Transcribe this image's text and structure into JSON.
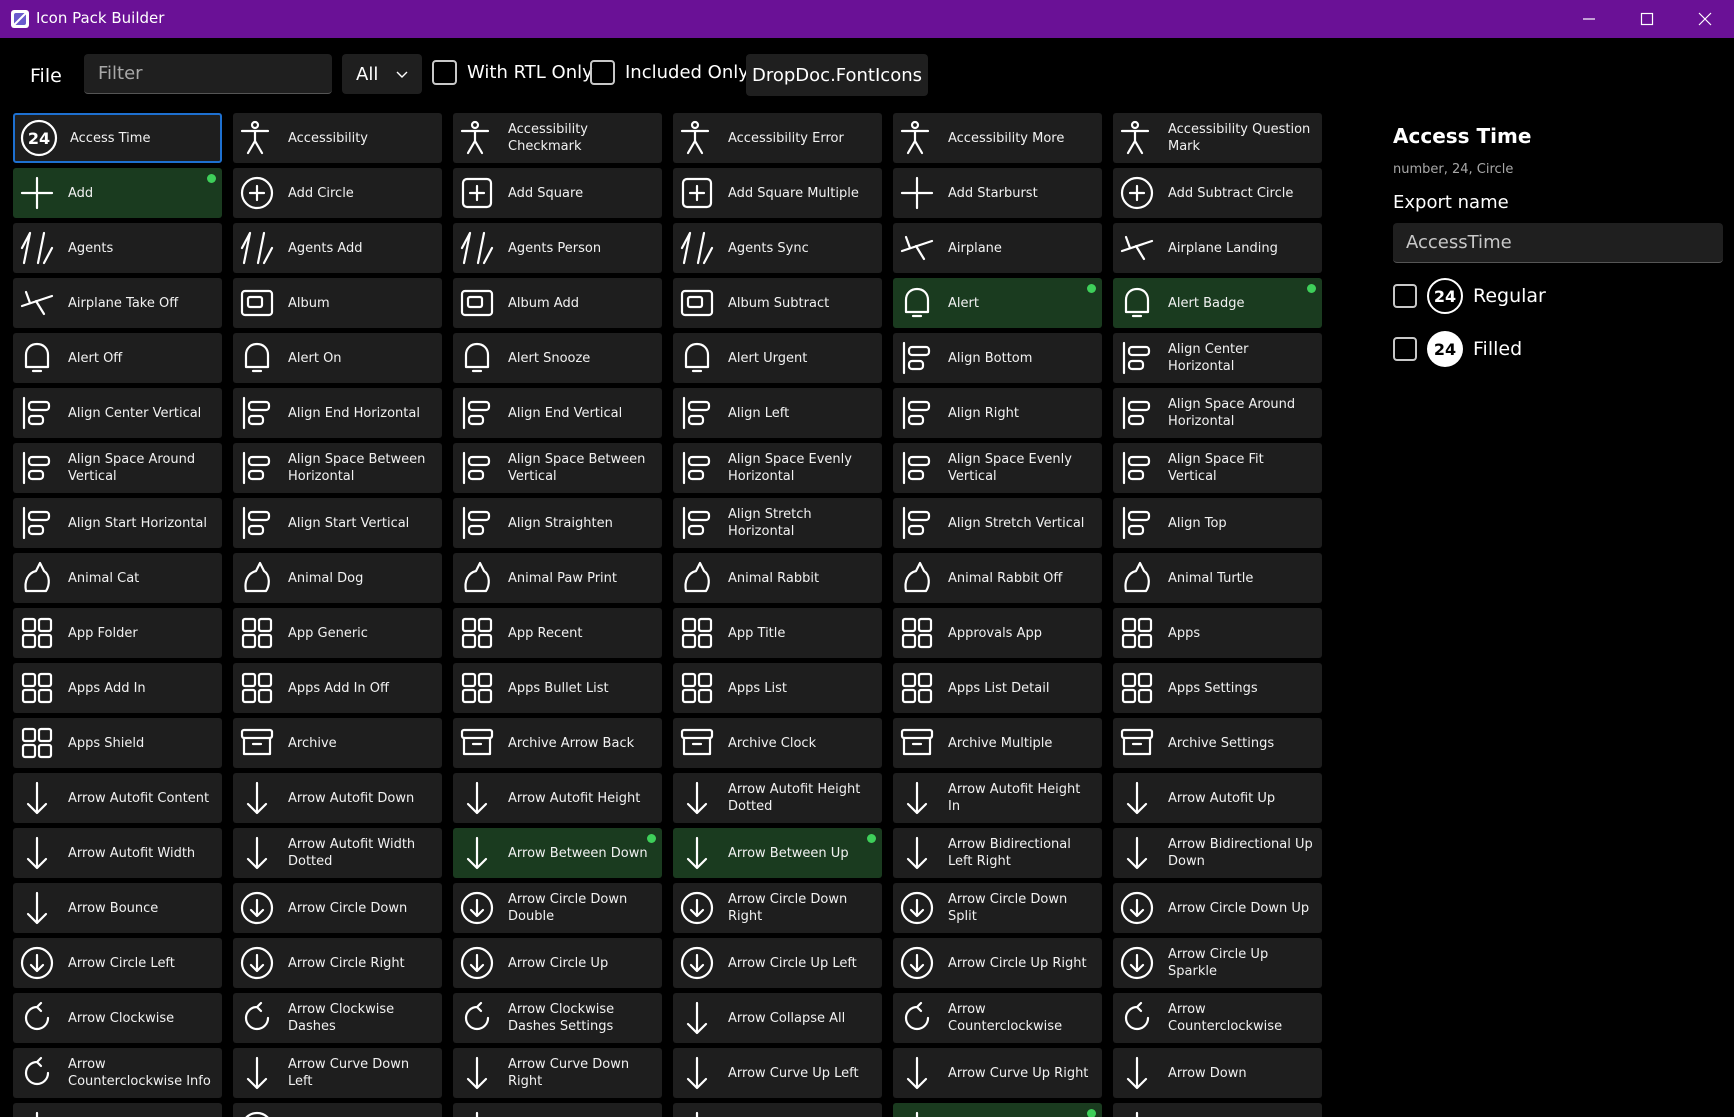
{
  "window": {
    "title": "Icon Pack Builder"
  },
  "toolbar": {
    "file_label": "File",
    "filter_placeholder": "Filter",
    "filter_value": "",
    "scope_value": "All",
    "rtl_label": "With RTL Only",
    "included_label": "Included Only",
    "pack_label": "DropDoc.FontIcons"
  },
  "colors": {
    "titlebar": "#6a1196",
    "included": "#1a3b1f",
    "dot": "#3ecf5a",
    "selection": "#1e70d0"
  },
  "icons": [
    {
      "label": "Access Time",
      "icon": "access-time-icon",
      "selected": true
    },
    {
      "label": "Accessibility",
      "icon": "accessibility-icon"
    },
    {
      "label": "Accessibility Checkmark",
      "icon": "accessibility-checkmark-icon"
    },
    {
      "label": "Accessibility Error",
      "icon": "accessibility-error-icon"
    },
    {
      "label": "Accessibility More",
      "icon": "accessibility-more-icon"
    },
    {
      "label": "Accessibility Question Mark",
      "icon": "accessibility-question-mark-icon"
    },
    {
      "label": "Add",
      "icon": "add-icon",
      "included": true
    },
    {
      "label": "Add Circle",
      "icon": "add-circle-icon"
    },
    {
      "label": "Add Square",
      "icon": "add-square-icon"
    },
    {
      "label": "Add Square Multiple",
      "icon": "add-square-multiple-icon"
    },
    {
      "label": "Add Starburst",
      "icon": "add-starburst-icon"
    },
    {
      "label": "Add Subtract Circle",
      "icon": "add-subtract-circle-icon"
    },
    {
      "label": "Agents",
      "icon": "agents-icon"
    },
    {
      "label": "Agents Add",
      "icon": "agents-add-icon"
    },
    {
      "label": "Agents Person",
      "icon": "agents-person-icon"
    },
    {
      "label": "Agents Sync",
      "icon": "agents-sync-icon"
    },
    {
      "label": "Airplane",
      "icon": "airplane-icon"
    },
    {
      "label": "Airplane Landing",
      "icon": "airplane-landing-icon"
    },
    {
      "label": "Airplane Take Off",
      "icon": "airplane-take-off-icon"
    },
    {
      "label": "Album",
      "icon": "album-icon"
    },
    {
      "label": "Album Add",
      "icon": "album-add-icon"
    },
    {
      "label": "Album Subtract",
      "icon": "album-subtract-icon"
    },
    {
      "label": "Alert",
      "icon": "alert-icon",
      "included": true
    },
    {
      "label": "Alert Badge",
      "icon": "alert-badge-icon",
      "included": true
    },
    {
      "label": "Alert Off",
      "icon": "alert-off-icon"
    },
    {
      "label": "Alert On",
      "icon": "alert-on-icon"
    },
    {
      "label": "Alert Snooze",
      "icon": "alert-snooze-icon"
    },
    {
      "label": "Alert Urgent",
      "icon": "alert-urgent-icon"
    },
    {
      "label": "Align Bottom",
      "icon": "align-bottom-icon"
    },
    {
      "label": "Align Center Horizontal",
      "icon": "align-center-horizontal-icon"
    },
    {
      "label": "Align Center Vertical",
      "icon": "align-center-vertical-icon"
    },
    {
      "label": "Align End Horizontal",
      "icon": "align-end-horizontal-icon"
    },
    {
      "label": "Align End Vertical",
      "icon": "align-end-vertical-icon"
    },
    {
      "label": "Align Left",
      "icon": "align-left-icon"
    },
    {
      "label": "Align Right",
      "icon": "align-right-icon"
    },
    {
      "label": "Align Space Around Horizontal",
      "icon": "align-space-around-horizontal-icon"
    },
    {
      "label": "Align Space Around Vertical",
      "icon": "align-space-around-vertical-icon"
    },
    {
      "label": "Align Space Between Horizontal",
      "icon": "align-space-between-horizontal-icon"
    },
    {
      "label": "Align Space Between Vertical",
      "icon": "align-space-between-vertical-icon"
    },
    {
      "label": "Align Space Evenly Horizontal",
      "icon": "align-space-evenly-horizontal-icon"
    },
    {
      "label": "Align Space Evenly Vertical",
      "icon": "align-space-evenly-vertical-icon"
    },
    {
      "label": "Align Space Fit Vertical",
      "icon": "align-space-fit-vertical-icon"
    },
    {
      "label": "Align Start Horizontal",
      "icon": "align-start-horizontal-icon"
    },
    {
      "label": "Align Start Vertical",
      "icon": "align-start-vertical-icon"
    },
    {
      "label": "Align Straighten",
      "icon": "align-straighten-icon"
    },
    {
      "label": "Align Stretch Horizontal",
      "icon": "align-stretch-horizontal-icon"
    },
    {
      "label": "Align Stretch Vertical",
      "icon": "align-stretch-vertical-icon"
    },
    {
      "label": "Align Top",
      "icon": "align-top-icon"
    },
    {
      "label": "Animal Cat",
      "icon": "animal-cat-icon"
    },
    {
      "label": "Animal Dog",
      "icon": "animal-dog-icon"
    },
    {
      "label": "Animal Paw Print",
      "icon": "animal-paw-print-icon"
    },
    {
      "label": "Animal Rabbit",
      "icon": "animal-rabbit-icon"
    },
    {
      "label": "Animal Rabbit Off",
      "icon": "animal-rabbit-off-icon"
    },
    {
      "label": "Animal Turtle",
      "icon": "animal-turtle-icon"
    },
    {
      "label": "App Folder",
      "icon": "app-folder-icon"
    },
    {
      "label": "App Generic",
      "icon": "app-generic-icon"
    },
    {
      "label": "App Recent",
      "icon": "app-recent-icon"
    },
    {
      "label": "App Title",
      "icon": "app-title-icon"
    },
    {
      "label": "Approvals App",
      "icon": "approvals-app-icon"
    },
    {
      "label": "Apps",
      "icon": "apps-icon"
    },
    {
      "label": "Apps Add In",
      "icon": "apps-add-in-icon"
    },
    {
      "label": "Apps Add In Off",
      "icon": "apps-add-in-off-icon"
    },
    {
      "label": "Apps Bullet List",
      "icon": "apps-bullet-list-icon"
    },
    {
      "label": "Apps List",
      "icon": "apps-list-icon"
    },
    {
      "label": "Apps List Detail",
      "icon": "apps-list-detail-icon"
    },
    {
      "label": "Apps Settings",
      "icon": "apps-settings-icon"
    },
    {
      "label": "Apps Shield",
      "icon": "apps-shield-icon"
    },
    {
      "label": "Archive",
      "icon": "archive-icon"
    },
    {
      "label": "Archive Arrow Back",
      "icon": "archive-arrow-back-icon"
    },
    {
      "label": "Archive Clock",
      "icon": "archive-clock-icon"
    },
    {
      "label": "Archive Multiple",
      "icon": "archive-multiple-icon"
    },
    {
      "label": "Archive Settings",
      "icon": "archive-settings-icon"
    },
    {
      "label": "Arrow Autofit Content",
      "icon": "arrow-autofit-content-icon"
    },
    {
      "label": "Arrow Autofit Down",
      "icon": "arrow-autofit-down-icon"
    },
    {
      "label": "Arrow Autofit Height",
      "icon": "arrow-autofit-height-icon"
    },
    {
      "label": "Arrow Autofit Height Dotted",
      "icon": "arrow-autofit-height-dotted-icon"
    },
    {
      "label": "Arrow Autofit Height In",
      "icon": "arrow-autofit-height-in-icon"
    },
    {
      "label": "Arrow Autofit Up",
      "icon": "arrow-autofit-up-icon"
    },
    {
      "label": "Arrow Autofit Width",
      "icon": "arrow-autofit-width-icon"
    },
    {
      "label": "Arrow Autofit Width Dotted",
      "icon": "arrow-autofit-width-dotted-icon"
    },
    {
      "label": "Arrow Between Down",
      "icon": "arrow-between-down-icon",
      "included": true
    },
    {
      "label": "Arrow Between Up",
      "icon": "arrow-between-up-icon",
      "included": true
    },
    {
      "label": "Arrow Bidirectional Left Right",
      "icon": "arrow-bidirectional-left-right-icon"
    },
    {
      "label": "Arrow Bidirectional Up Down",
      "icon": "arrow-bidirectional-up-down-icon"
    },
    {
      "label": "Arrow Bounce",
      "icon": "arrow-bounce-icon"
    },
    {
      "label": "Arrow Circle Down",
      "icon": "arrow-circle-down-icon"
    },
    {
      "label": "Arrow Circle Down Double",
      "icon": "arrow-circle-down-double-icon"
    },
    {
      "label": "Arrow Circle Down Right",
      "icon": "arrow-circle-down-right-icon"
    },
    {
      "label": "Arrow Circle Down Split",
      "icon": "arrow-circle-down-split-icon"
    },
    {
      "label": "Arrow Circle Down Up",
      "icon": "arrow-circle-down-up-icon"
    },
    {
      "label": "Arrow Circle Left",
      "icon": "arrow-circle-left-icon"
    },
    {
      "label": "Arrow Circle Right",
      "icon": "arrow-circle-right-icon"
    },
    {
      "label": "Arrow Circle Up",
      "icon": "arrow-circle-up-icon"
    },
    {
      "label": "Arrow Circle Up Left",
      "icon": "arrow-circle-up-left-icon"
    },
    {
      "label": "Arrow Circle Up Right",
      "icon": "arrow-circle-up-right-icon"
    },
    {
      "label": "Arrow Circle Up Sparkle",
      "icon": "arrow-circle-up-sparkle-icon"
    },
    {
      "label": "Arrow Clockwise",
      "icon": "arrow-clockwise-icon"
    },
    {
      "label": "Arrow Clockwise Dashes",
      "icon": "arrow-clockwise-dashes-icon"
    },
    {
      "label": "Arrow Clockwise Dashes Settings",
      "icon": "arrow-clockwise-dashes-settings-icon"
    },
    {
      "label": "Arrow Collapse All",
      "icon": "arrow-collapse-all-icon"
    },
    {
      "label": "Arrow Counterclockwise",
      "icon": "arrow-counterclockwise-icon"
    },
    {
      "label": "Arrow Counterclockwise",
      "icon": "arrow-counterclockwise-dashes-icon"
    },
    {
      "label": "Arrow Counterclockwise Info",
      "icon": "arrow-counterclockwise-info-icon"
    },
    {
      "label": "Arrow Curve Down Left",
      "icon": "arrow-curve-down-left-icon"
    },
    {
      "label": "Arrow Curve Down Right",
      "icon": "arrow-curve-down-right-icon"
    },
    {
      "label": "Arrow Curve Up Left",
      "icon": "arrow-curve-up-left-icon"
    },
    {
      "label": "Arrow Curve Up Right",
      "icon": "arrow-curve-up-right-icon"
    },
    {
      "label": "Arrow Down",
      "icon": "arrow-down-icon"
    },
    {
      "label": "",
      "icon": "arrow-down-left-icon"
    },
    {
      "label": "",
      "icon": "arrow-down-left-circle-icon"
    },
    {
      "label": "",
      "icon": "arrow-down-right-icon"
    },
    {
      "label": "",
      "icon": "arrow-download-icon"
    },
    {
      "label": "",
      "icon": "arrow-enter-icon",
      "included": true
    },
    {
      "label": "",
      "icon": "arrow-eject-icon"
    }
  ],
  "details": {
    "title": "Access Time",
    "tags": "number, 24, Circle",
    "export_label": "Export name",
    "export_value": "AccessTime",
    "variants": [
      {
        "badge": "24",
        "label": "Regular"
      },
      {
        "badge": "24",
        "label": "Filled"
      }
    ]
  }
}
